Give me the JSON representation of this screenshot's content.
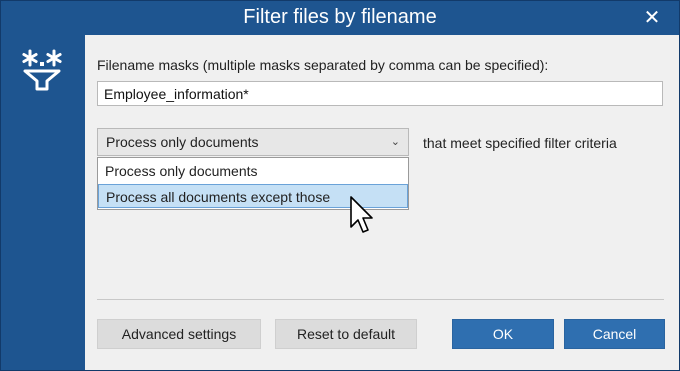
{
  "window": {
    "title": "Filter files by filename",
    "close_label": "✕"
  },
  "form": {
    "masks_label": "Filename masks (multiple masks separated by comma can be specified):",
    "masks_value": "Employee_information*",
    "mode_selected": "Process only documents",
    "criteria_text": "that meet specified filter criteria",
    "options": [
      "Process only documents",
      "Process all documents except those"
    ],
    "highlighted_option_index": 1
  },
  "buttons": {
    "advanced": "Advanced settings",
    "reset": "Reset to default",
    "ok": "OK",
    "cancel": "Cancel"
  },
  "icons": {
    "filter": "filter-asterisk-icon",
    "close": "close-icon",
    "chevron": "chevron-down-icon",
    "cursor": "mouse-pointer-icon"
  },
  "colors": {
    "titlebar": "#1e5590",
    "primary_button": "#2f6fb0",
    "highlight": "#c5e0f5"
  }
}
